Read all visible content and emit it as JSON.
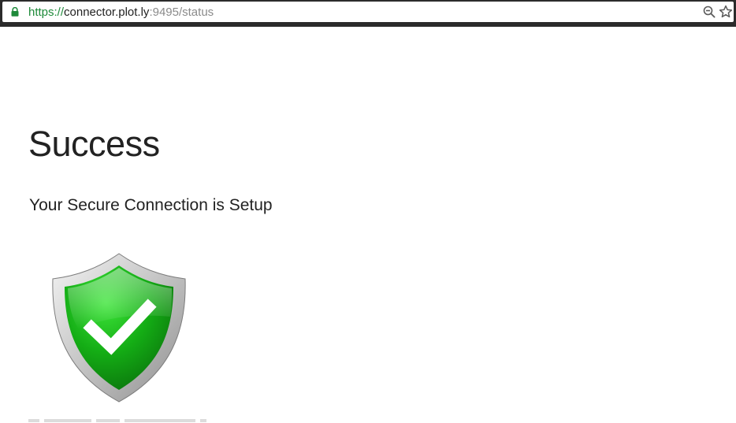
{
  "browser": {
    "url_scheme": "https://",
    "url_host": "connector.plot.ly",
    "url_rest": ":9495/status",
    "icons": {
      "lock": "lock-icon",
      "zoom": "zoom-out-icon",
      "bookmark": "star-icon"
    },
    "colors": {
      "secure": "#1e8a3a"
    }
  },
  "main": {
    "title": "Success",
    "subtitle": "Your Secure Connection is Setup",
    "status_icon": "shield-check-icon",
    "colors": {
      "shield_green": "#19b51a",
      "shield_rim": "#c9c9c9"
    }
  }
}
